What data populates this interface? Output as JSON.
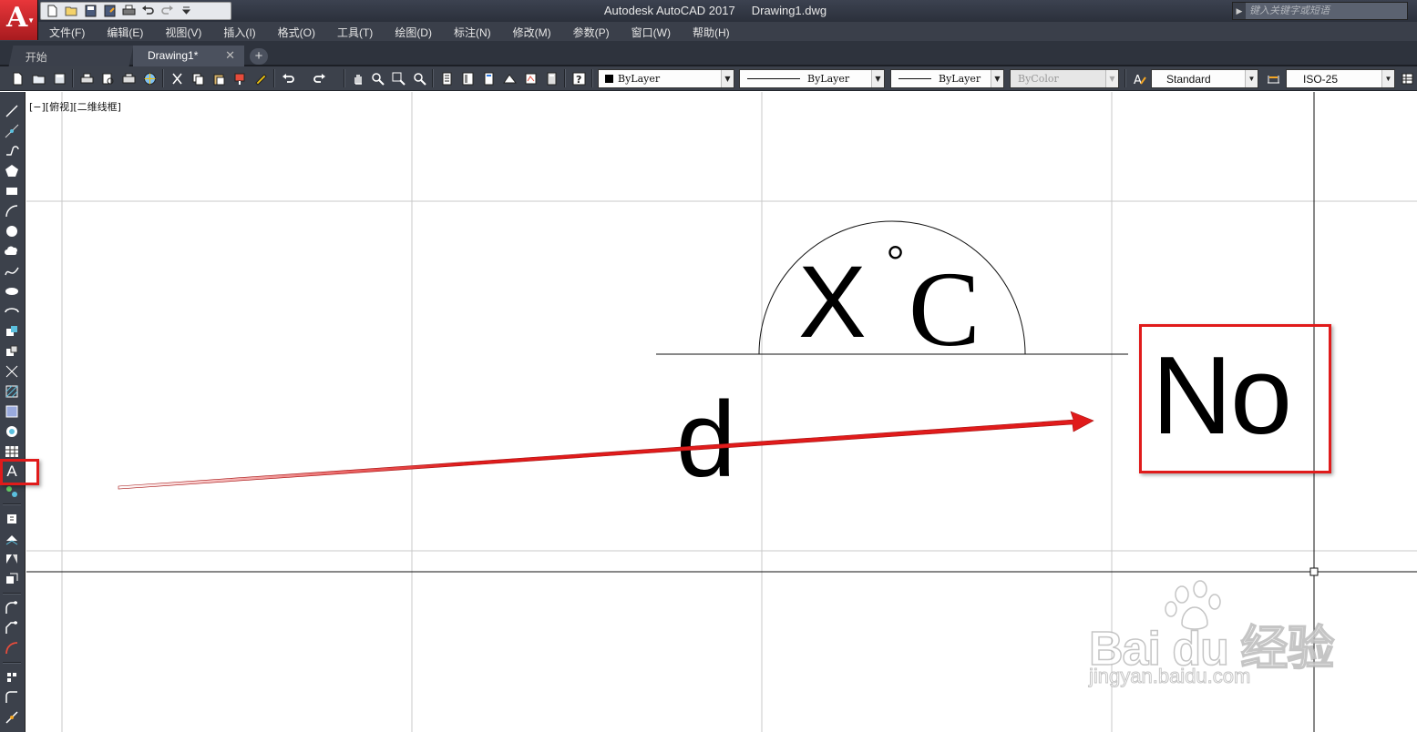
{
  "app": {
    "logo_letter": "A",
    "title": "Autodesk AutoCAD 2017     Drawing1.dwg",
    "search_placeholder": "键入关键字或短语"
  },
  "quick_access": [
    "new-icon",
    "open-icon",
    "save-icon",
    "save-as-icon",
    "plot-icon",
    "undo-icon",
    "redo-icon",
    "customize-icon"
  ],
  "menu": [
    "文件(F)",
    "编辑(E)",
    "视图(V)",
    "插入(I)",
    "格式(O)",
    "工具(T)",
    "绘图(D)",
    "标注(N)",
    "修改(M)",
    "参数(P)",
    "窗口(W)",
    "帮助(H)"
  ],
  "tabs": {
    "start": "开始",
    "drawing": "Drawing1*",
    "close_glyph": "✕",
    "add_glyph": "+"
  },
  "toolbar": {
    "color_combo": "ByLayer",
    "linetype_combo": "ByLayer",
    "lineweight_combo": "ByLayer",
    "plotstyle_combo": "ByColor",
    "text_style_combo": "Standard",
    "dim_style_combo": "ISO-25",
    "dropdown_glyph": "▼"
  },
  "left_toolbar": {
    "text_tool_label": "A"
  },
  "viewport": {
    "label": "[−][俯视][二维线框]"
  },
  "drawing": {
    "text_x": "X",
    "text_degree": "°",
    "text_c": "C",
    "text_d": "d",
    "text_no": "No"
  },
  "annotations": {
    "highlight_color": "#e01b1b",
    "arrow_color": "#e01b1b"
  },
  "watermark": {
    "brand": "Bai  du 经验",
    "url": "jingyan.baidu.com"
  },
  "colors": {
    "titlebar": "#2b303b",
    "toolbar": "#3c414b",
    "canvas": "#ffffff",
    "grid": "#c8c8c8"
  }
}
